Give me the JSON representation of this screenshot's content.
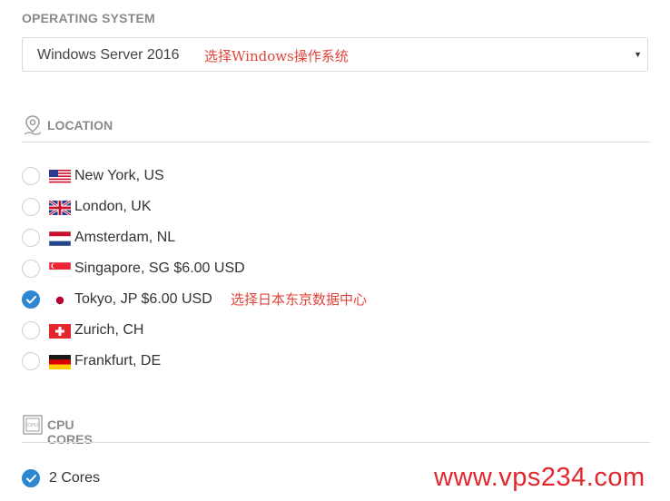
{
  "os": {
    "title": "OPERATING SYSTEM",
    "selected": "Windows Server 2016",
    "annotation": "选择Windows操作系统",
    "caret": "▼"
  },
  "location": {
    "title": "LOCATION",
    "items": [
      {
        "label": "New York, US",
        "flag": "us-flag-icon",
        "checked": false
      },
      {
        "label": "London, UK",
        "flag": "uk-flag-icon",
        "checked": false
      },
      {
        "label": "Amsterdam, NL",
        "flag": "nl-flag-icon",
        "checked": false
      },
      {
        "label": "Singapore, SG $6.00 USD",
        "flag": "sg-flag-icon",
        "checked": false
      },
      {
        "label": "Tokyo, JP $6.00 USD",
        "flag": "jp-flag-icon",
        "checked": true
      },
      {
        "label": "Zurich, CH",
        "flag": "ch-flag-icon",
        "checked": false
      },
      {
        "label": "Frankfurt, DE",
        "flag": "de-flag-icon",
        "checked": false
      }
    ],
    "annotation": "选择日本东京数据中心"
  },
  "cpu": {
    "title": "CPU CORES",
    "icon_text": "CPU",
    "selected": "2 Cores"
  },
  "watermark": "www.vps234.com",
  "colors": {
    "accent": "#2e86d0",
    "annotation": "#e0443a",
    "watermark": "#e3262e",
    "section_title": "#8a8a8a"
  }
}
